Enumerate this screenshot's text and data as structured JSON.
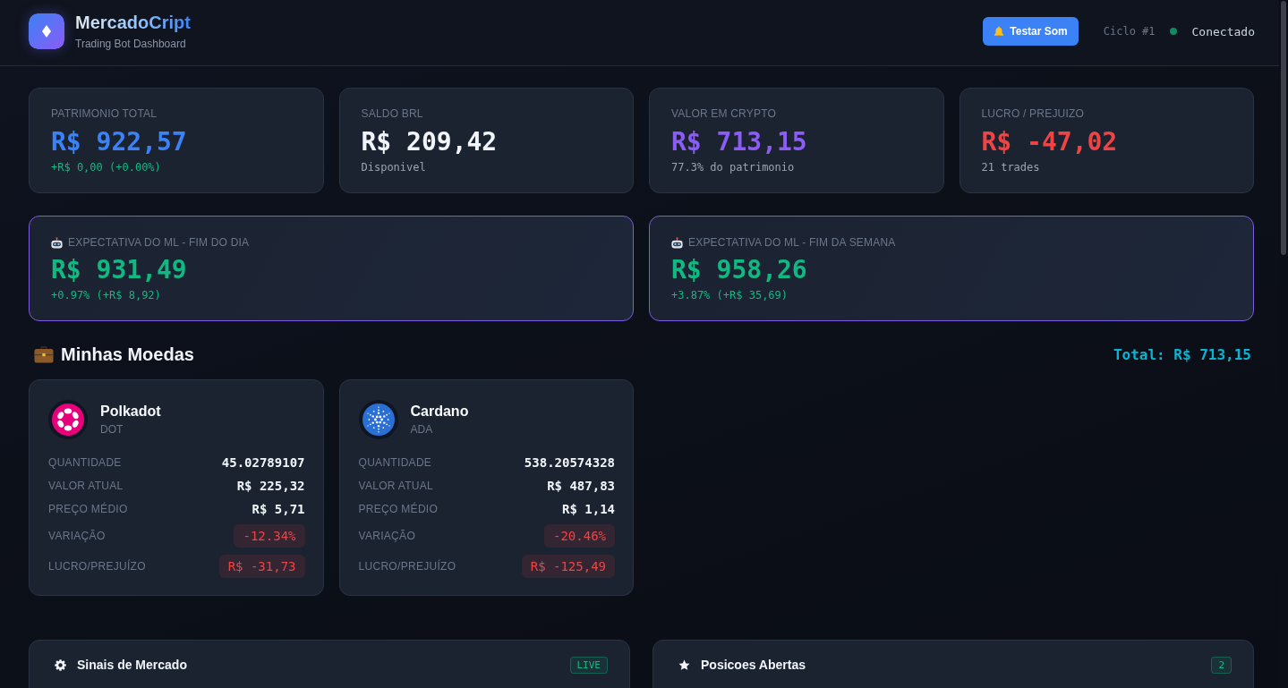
{
  "header": {
    "title": "MercadoCript",
    "subtitle": "Trading Bot Dashboard",
    "sound_button": "Testar Som",
    "cycle": "Ciclo #1",
    "connection": {
      "connected": true,
      "label": "Conectado"
    }
  },
  "stats": [
    {
      "label": "PATRIMONIO TOTAL",
      "value": "R$ 922,57",
      "color": "#3b82f6",
      "note": "+R$ 0,00 (+0.00%)",
      "highlight": true
    },
    {
      "label": "SALDO BRL",
      "value": "R$ 209,42",
      "color": "#f1f5f9",
      "note": "Disponivel",
      "highlight": false
    },
    {
      "label": "VALOR EM CRYPTO",
      "value": "R$ 713,15",
      "color": "#8b5cf6",
      "note": "77.3% do patrimonio",
      "highlight": false
    },
    {
      "label": "LUCRO / PREJUIZO",
      "value": "R$ -47,02",
      "color": "#ef4444",
      "note": "21 trades",
      "highlight": false
    }
  ],
  "ml_forecasts": [
    {
      "label": "EXPECTATIVA DO ML - FIM DO DIA",
      "value": "R$ 931,49",
      "change": "+0.97% (+R$ 8,92)",
      "positive": true
    },
    {
      "label": "EXPECTATIVA DO ML - FIM DA SEMANA",
      "value": "R$ 958,26",
      "change": "+3.87% (+R$ 35,69)",
      "positive": true
    }
  ],
  "portfolio": {
    "title": "Minhas Moedas",
    "total": "Total: R$ 713,15",
    "coins": [
      {
        "name": "Polkadot",
        "symbol": "DOT",
        "kind": "ring",
        "color": "#e6007a",
        "rows": [
          {
            "label": "QUANTIDADE",
            "value": "45.02789107",
            "kind": "plain"
          },
          {
            "label": "VALOR ATUAL",
            "value": "R$ 225,32",
            "kind": "plain"
          },
          {
            "label": "PREÇO MÉDIO",
            "value": "R$ 5,71",
            "kind": "plain"
          },
          {
            "label": "VARIAÇÃO",
            "value": "-12.34%",
            "kind": "loss"
          },
          {
            "label": "LUCRO/PREJUÍZO",
            "value": "R$ -31,73",
            "kind": "loss"
          }
        ]
      },
      {
        "name": "Cardano",
        "symbol": "ADA",
        "kind": "burst",
        "color": "#2a6fd4",
        "rows": [
          {
            "label": "QUANTIDADE",
            "value": "538.20574328",
            "kind": "plain"
          },
          {
            "label": "VALOR ATUAL",
            "value": "R$ 487,83",
            "kind": "plain"
          },
          {
            "label": "PREÇO MÉDIO",
            "value": "R$ 1,14",
            "kind": "plain"
          },
          {
            "label": "VARIAÇÃO",
            "value": "-20.46%",
            "kind": "loss"
          },
          {
            "label": "LUCRO/PREJUÍZO",
            "value": "R$ -125,49",
            "kind": "loss"
          }
        ]
      }
    ]
  },
  "panels": [
    {
      "kind": "signals",
      "title": "Sinais de Mercado",
      "badge": "LIVE"
    },
    {
      "kind": "positions",
      "title": "Posicoes Abertas",
      "badge": "2"
    }
  ]
}
